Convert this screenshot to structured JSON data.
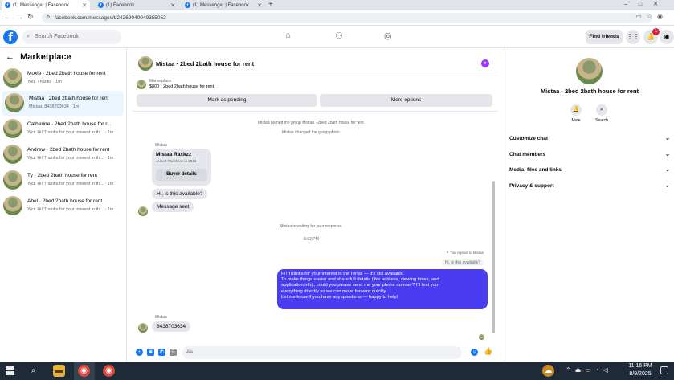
{
  "browser": {
    "tabs": [
      {
        "label": "(1) Messenger | Facebook",
        "active": true
      },
      {
        "label": "(1) Facebook",
        "active": false
      },
      {
        "label": "(1) Messenger | Facebook",
        "active": false
      }
    ],
    "new_tab": "+",
    "url": "facebook.com/messages/t/24269040049355052"
  },
  "fb": {
    "logo": "f",
    "search_placeholder": "Search Facebook",
    "find_friends": "Find friends",
    "notifications_badge": "1"
  },
  "sidebar": {
    "title": "Marketplace",
    "conversations": [
      {
        "title": "Moxie · 2bed 2bath house for rent",
        "sub": "You: Thanks · 1m",
        "selected": false
      },
      {
        "title": "Mistaa · 2bed 2bath house for rent",
        "sub": "Mistaa: 8438703634 · 1m",
        "selected": true
      },
      {
        "title": "Catherine · 2bed 2bath house for r...",
        "sub": "You: Hi! Thanks for your interest in th... · 1m",
        "selected": false
      },
      {
        "title": "Andrew · 2bed 2bath house for rent",
        "sub": "You: Hi! Thanks for your interest in th... · 1m",
        "selected": false
      },
      {
        "title": "Ty · 2bed 2bath house for rent",
        "sub": "You: Hi! Thanks for your interest in th... · 1m",
        "selected": false
      },
      {
        "title": "Abel · 2bed 2bath house for rent",
        "sub": "You: Hi! Thanks for your interest in th... · 1m",
        "selected": false
      }
    ]
  },
  "chat": {
    "title": "Mistaa · 2bed 2bath house for rent",
    "marketplace_label": "Marketplace",
    "listing": "$800 · 2bed 2bath house for rent",
    "mark_pending": "Mark as pending",
    "more_options": "More options",
    "system_1": "Mistaa named the group Mistaa · 2bed 2bath house for rent.",
    "system_2": "Mistaa changed the group photo.",
    "sender_1": "Mistaa",
    "card_name": "Mistaa Raxkzz",
    "card_joined": "Joined Facebook in 2018",
    "card_button": "Buyer details",
    "msg_1": "Hi, is this available?",
    "msg_2": "Message sent",
    "waiting": "Mistaa is waiting for your response.",
    "time": "5:52 PM",
    "replied_to": "You replied to Mistaa",
    "quote": "Hi, is this available?",
    "reply_lines": [
      "Hi! Thanks for your interest in the rental — it's still available.",
      "To make things easier and share full details (like address, viewing times, and",
      "application info), could you please send me your phone number? I'll text you",
      "everything directly so we can move forward quickly.",
      "Let me know if you have any questions — happy to help!"
    ],
    "sender_2": "Mistaa",
    "msg_3": "8438703634",
    "composer_placeholder": "Aa"
  },
  "details": {
    "name": "Mistaa · 2bed 2bath house for rent",
    "mute": "Mute",
    "search": "Search",
    "sections": [
      "Customize chat",
      "Chat members",
      "Media, files and links",
      "Privacy & support"
    ]
  },
  "taskbar": {
    "time": "11:16 PM",
    "date": "8/9/2025"
  },
  "colors": {
    "fb_blue": "#1877f2",
    "outgoing_bubble": "#4a3cf0",
    "selected_row": "#ebf5ff"
  },
  "icons": [
    "facebook-logo-icon",
    "search-icon",
    "home-icon",
    "friends-icon",
    "marketplace-icon",
    "grid-icon",
    "bell-icon",
    "back-arrow-icon",
    "like-icon"
  ]
}
